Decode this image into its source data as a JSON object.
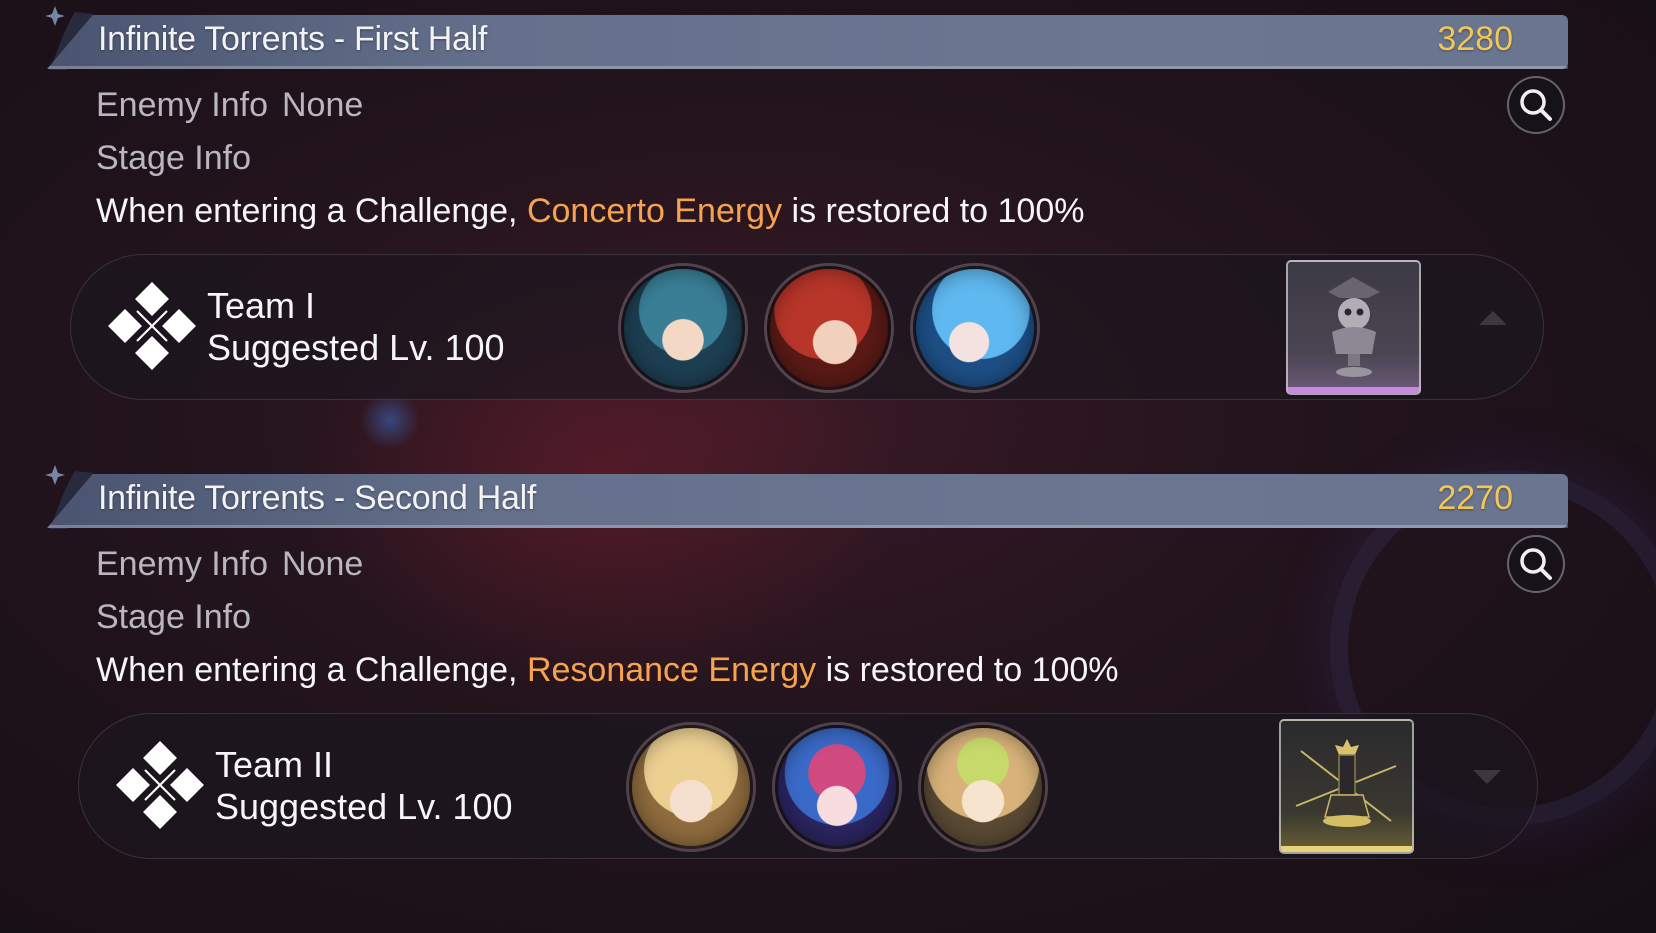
{
  "sections": [
    {
      "title": "Infinite Torrents - First Half",
      "score": "3280",
      "enemy_label": "Enemy Info",
      "enemy_value": "None",
      "stage_label": "Stage Info",
      "stage_desc_prefix": "When entering a Challenge, ",
      "stage_desc_highlight": "Concerto Energy",
      "stage_desc_suffix": " is restored to 100%",
      "team_name": "Team I",
      "team_level": "Suggested Lv. 100",
      "avatars": [
        "teal-haired-character-avatar",
        "red-haired-glasses-character-avatar",
        "blue-haired-character-avatar"
      ],
      "echo_icon": "skull-bust-echo-icon",
      "echo_rarity_color": "#c58ae0"
    },
    {
      "title": "Infinite Torrents - Second Half",
      "score": "2270",
      "enemy_label": "Enemy Info",
      "enemy_value": "None",
      "stage_label": "Stage Info",
      "stage_desc_prefix": "When entering a Challenge, ",
      "stage_desc_highlight": "Resonance Energy",
      "stage_desc_suffix": " is restored to 100%",
      "team_name": "Team II",
      "team_level": "Suggested Lv. 100",
      "avatars": [
        "blonde-crowned-character-avatar",
        "pink-blue-haired-character-avatar",
        "green-ribbon-character-avatar"
      ],
      "echo_icon": "chess-king-echo-icon",
      "echo_rarity_color": "#e8d27a"
    }
  ],
  "colors": {
    "highlight": "#f6a350",
    "score": "#f5c656"
  }
}
